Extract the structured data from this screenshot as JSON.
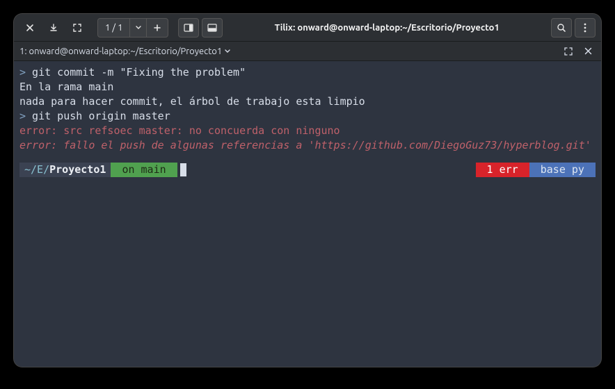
{
  "titlebar": {
    "session_count": "1 / 1",
    "title": "Tilix: onward@onward-laptop:~/Escritorio/Proyecto1"
  },
  "tabbar": {
    "tab_label": "1: onward@onward-laptop:~/Escritorio/Proyecto1"
  },
  "terminal": {
    "line1_prompt": ">",
    "line1_cmd": " git commit -m \"Fixing the problem\"",
    "line2": "En la rama main",
    "line3": "nada para hacer commit, el árbol de trabajo esta limpio",
    "line4_prompt": ">",
    "line4_cmd": " git push origin master",
    "line5": "error: src refsoec master: no concuerda con ninguno",
    "line6_a": "error: fallo el push de algunas referencias a '",
    "line6_b": "https://github.com/DiegoGuz73/hyperblog.git",
    "line6_c": "'"
  },
  "status": {
    "path_prefix": "~/E/",
    "path_bold": "Proyecto1",
    "branch": " on main ",
    "err": " 1 err ",
    "env": " base py "
  }
}
